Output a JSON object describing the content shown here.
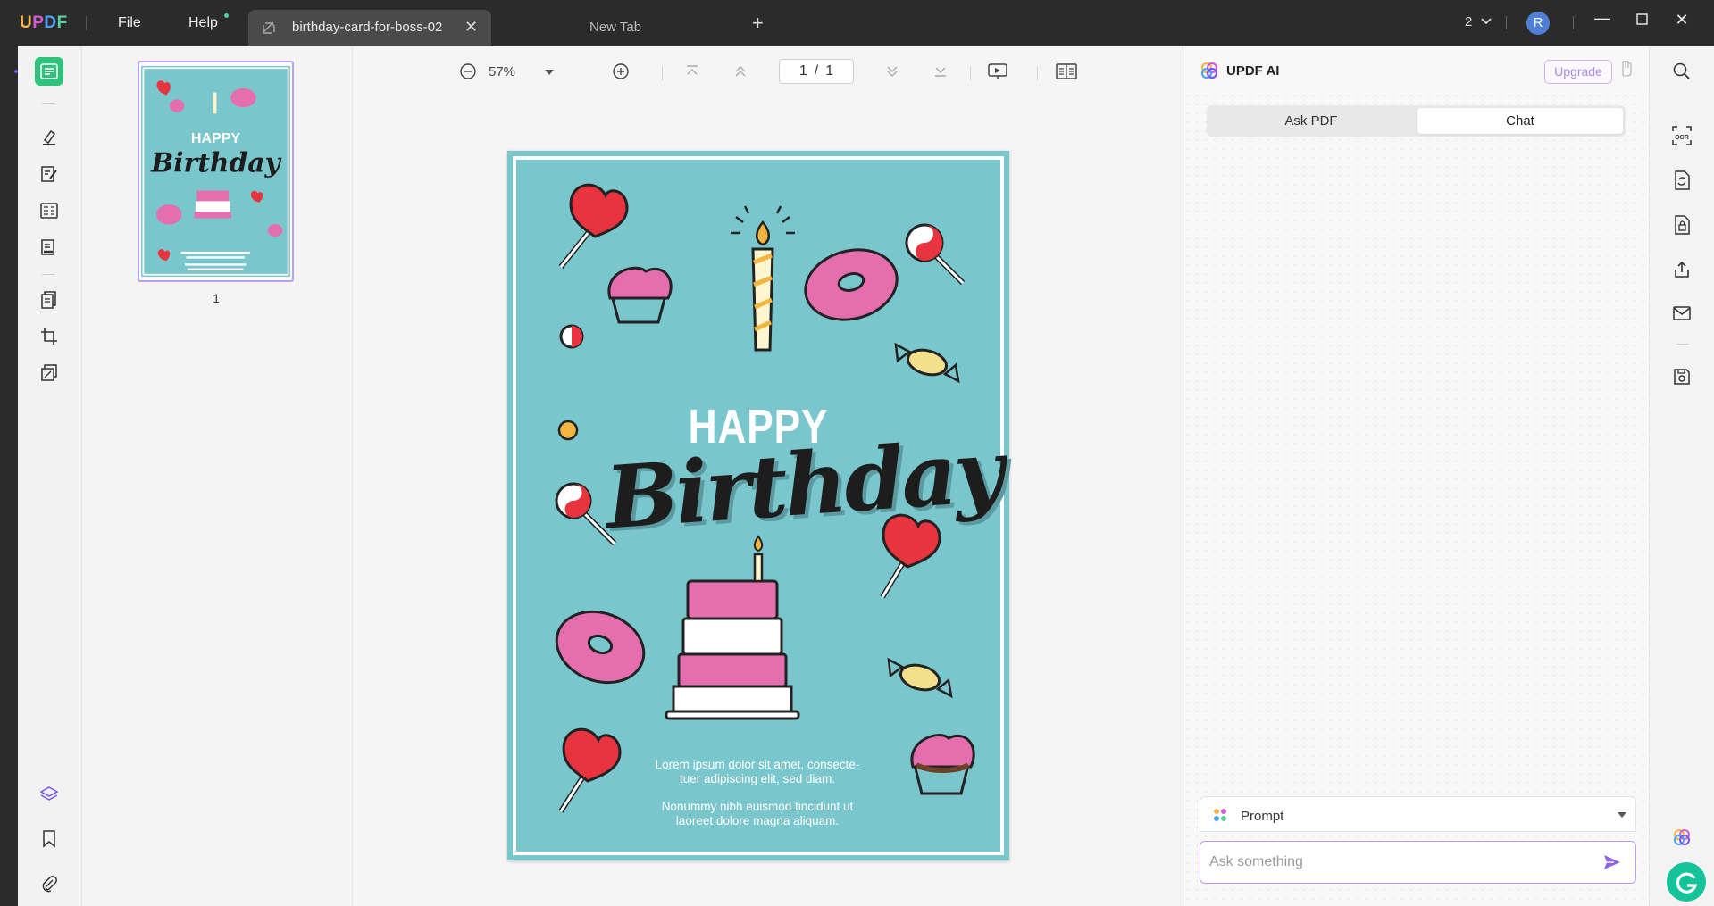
{
  "titlebar": {
    "logo": "UPDF",
    "menu_file": "File",
    "menu_help": "Help",
    "active_tab_title": "birthday-card-for-boss-02",
    "new_tab_title": "New Tab",
    "window_count": "2",
    "avatar_initial": "R"
  },
  "viewer": {
    "zoom": "57%",
    "current_page": "1",
    "page_sep": "/",
    "total_pages": "1"
  },
  "thumbnails": {
    "page_number": "1"
  },
  "card": {
    "happy": "HAPPY",
    "birthday": "Birthday",
    "para1_line1": "Lorem ipsum dolor sit amet, consecte-",
    "para1_line2": "tuer adipiscing elit, sed diam.",
    "para2_line1": "Nonummy nibh euismod tincidunt ut",
    "para2_line2": "laoreet dolore magna aliquam.",
    "colors": {
      "background": "#7ac6cd",
      "pink": "#e56fae",
      "red": "#e8343f",
      "cream": "#fff8ee"
    }
  },
  "ai_panel": {
    "title": "UPDF AI",
    "upgrade_label": "Upgrade",
    "tab_ask_pdf": "Ask PDF",
    "tab_chat": "Chat",
    "prompt_label": "Prompt",
    "ask_placeholder": "Ask something",
    "accent": "#a98be8"
  }
}
